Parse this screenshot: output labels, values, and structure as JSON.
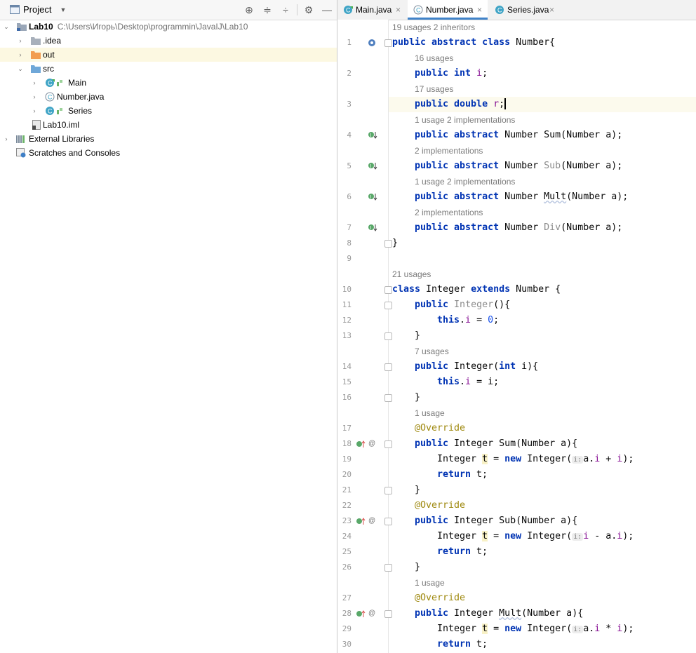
{
  "project": {
    "title": "Project",
    "tree": [
      {
        "label": "Lab10",
        "path": "C:\\Users\\Игорь\\Desktop\\programmin\\JavaIJ\\Lab10",
        "icon": "module-folder-icon",
        "expanded": true
      },
      {
        "label": ".idea",
        "icon": "folder-icon"
      },
      {
        "label": "out",
        "icon": "orange-folder-icon"
      },
      {
        "label": "src",
        "icon": "source-folder-icon",
        "expanded": true
      },
      {
        "label": "Main",
        "icon": "java-class-icon"
      },
      {
        "label": "Number.java",
        "icon": "java-file-icon"
      },
      {
        "label": "Series",
        "icon": "java-class-icon"
      },
      {
        "label": "Lab10.iml",
        "icon": "iml-file-icon"
      },
      {
        "label": "External Libraries",
        "icon": "library-icon"
      },
      {
        "label": "Scratches and Consoles",
        "icon": "scratches-icon"
      }
    ]
  },
  "tabs": [
    {
      "label": "Main.java",
      "active": false
    },
    {
      "label": "Number.java",
      "active": true
    },
    {
      "label": "Series.java",
      "active": false
    }
  ],
  "hints": {
    "h0": "19 usages    2 inheritors",
    "h1": "16 usages",
    "h2": "17 usages",
    "h4": "1 usage    2 implementations",
    "h5": "2 implementations",
    "h6": "1 usage    2 implementations",
    "h7": "2 implementations",
    "h10": "21 usages",
    "h14": "7 usages",
    "h17": "1 usage",
    "h27": "1 usage"
  },
  "code": {
    "l1a": "public abstract class",
    "l1b": " Number{",
    "l2a": "public int",
    "l2b": "i",
    "l2c": ";",
    "l3a": "public double",
    "l3b": "r",
    "l3c": ";",
    "l4a": "public abstract",
    "l4b": " Number Sum(Number a);",
    "l5a": "public abstract",
    "l5b": " Number ",
    "l5c": "Sub",
    "l5d": "(Number a);",
    "l6a": "public abstract",
    "l6b": " Number ",
    "l6c": "Mult",
    "l6d": "(Number a);",
    "l7a": "public abstract",
    "l7b": " Number ",
    "l7c": "Div",
    "l7d": "(Number a);",
    "l8": "}",
    "l10a": "class",
    "l10b": " Integer ",
    "l10c": "extends",
    "l10d": " Number {",
    "l11a": "public",
    "l11b": " Integer",
    "l11c": "(){",
    "l12a": "this",
    "l12b": ".",
    "l12c": "i",
    "l12d": " = ",
    "l12e": "0",
    "l12f": ";",
    "l13": "}",
    "l14a": "public",
    "l14b": " Integer(",
    "l14c": "int",
    "l14d": " i){",
    "l15a": "this",
    "l15b": ".",
    "l15c": "i",
    "l15d": " = i;",
    "l16": "}",
    "l17": "@Override",
    "l18a": "public",
    "l18b": " Integer Sum(Number a){",
    "l19a": "Integer ",
    "l19b": "t",
    "l19c": " = ",
    "l19d": "new",
    "l19e": " Integer(",
    "l19f": "i:",
    "l19g": "a.",
    "l19h": "i",
    "l19i": " + ",
    "l19j": "i",
    "l19k": ");",
    "l20a": "return",
    "l20b": " t;",
    "l21": "}",
    "l22": "@Override",
    "l23a": "public",
    "l23b": " Integer Sub(Number a){",
    "l24a": "Integer ",
    "l24b": "t",
    "l24c": " = ",
    "l24d": "new",
    "l24e": " Integer(",
    "l24f": "i:",
    "l24g": "i",
    "l24h": " - a.",
    "l24i": "i",
    "l24j": ");",
    "l25a": "return",
    "l25b": " t;",
    "l26": "}",
    "l27": "@Override",
    "l28a": "public",
    "l28b": " Integer ",
    "l28c": "Mult",
    "l28d": "(Number a){",
    "l29a": "Integer ",
    "l29b": "t",
    "l29c": " = ",
    "l29d": "new",
    "l29e": " Integer(",
    "l29f": "i:",
    "l29g": "a.",
    "l29h": "i",
    "l29i": " * ",
    "l29j": "i",
    "l29k": ");",
    "l30a": "return",
    "l30b": " t;"
  },
  "line_numbers": [
    "1",
    "2",
    "3",
    "4",
    "5",
    "6",
    "7",
    "8",
    "9",
    "10",
    "11",
    "12",
    "13",
    "14",
    "15",
    "16",
    "17",
    "18",
    "19",
    "20",
    "21",
    "22",
    "23",
    "24",
    "25",
    "26",
    "27",
    "28",
    "29",
    "30"
  ],
  "colors": {
    "keyword": "#0033b3",
    "field": "#871094",
    "number": "#1750eb",
    "annotation": "#9e880d",
    "selection_row": "#fcf8e1",
    "current_line": "#fcfaed",
    "active_tab_underline": "#4083c9"
  }
}
